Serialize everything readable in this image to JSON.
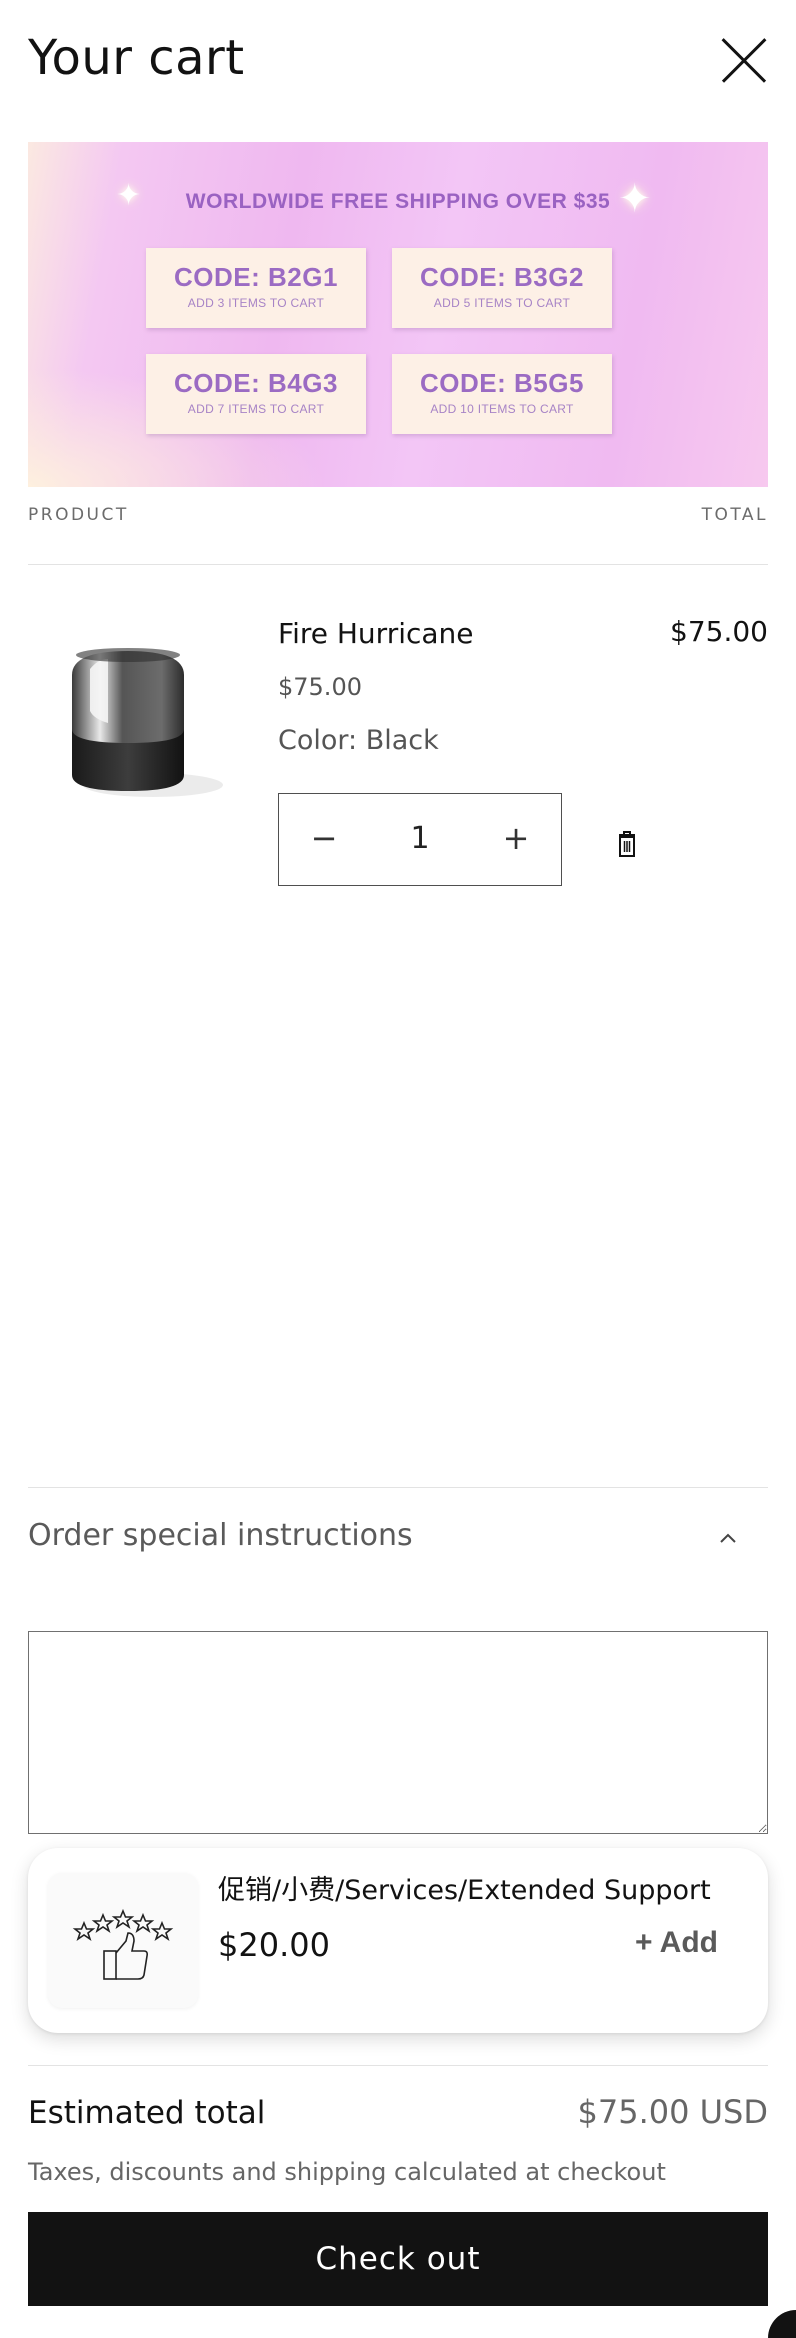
{
  "header": {
    "title": "Your cart",
    "close_icon": "close-icon"
  },
  "banner": {
    "headline": "WORLDWIDE FREE SHIPPING OVER $35",
    "codes": [
      {
        "code": "CODE: B2G1",
        "hint": "ADD 3 ITEMS TO CART"
      },
      {
        "code": "CODE: B3G2",
        "hint": "ADD 5 ITEMS TO CART"
      },
      {
        "code": "CODE: B4G3",
        "hint": "ADD 7 ITEMS TO CART"
      },
      {
        "code": "CODE: B5G5",
        "hint": "ADD 10 ITEMS TO CART"
      }
    ],
    "colors": {
      "text": "#9b6bc3",
      "card": "#fdf0e6",
      "bg": "#efb8f0"
    }
  },
  "table": {
    "product_header": "PRODUCT",
    "total_header": "TOTAL"
  },
  "item": {
    "name": "Fire Hurricane",
    "price": "$75.00",
    "color": "Color: Black",
    "line_total": "$75.00",
    "quantity": "1",
    "minus_label": "−",
    "plus_label": "+",
    "delete_icon": "trash-icon",
    "image": "black-speaker-product-image"
  },
  "instructions": {
    "label": "Order special instructions",
    "value": "",
    "chevron": "chevron-up-icon"
  },
  "upsell": {
    "title": "促销/小费/Services/Extended Support",
    "price": "$20.00",
    "add_label": "+ Add",
    "thumb_icon": "thumbs-up-stars-icon"
  },
  "summary": {
    "estimated_label": "Estimated total",
    "estimated_value": "$75.00 USD",
    "tax_note": "Taxes, discounts and shipping calculated at checkout",
    "checkout_label": "Check out"
  }
}
